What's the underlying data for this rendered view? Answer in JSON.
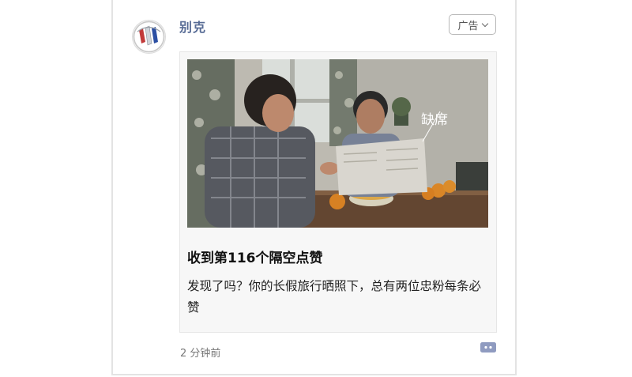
{
  "post": {
    "author": "别克",
    "ad_label": "广告",
    "headline": "收到第116个隔空点赞",
    "description": "发现了吗？你的长假旅行晒照下，总有两位忠粉每条必赞",
    "time": "2 分钟前",
    "photo_overlay_text": "缺席"
  },
  "icons": {
    "avatar": "buick-logo",
    "ad_menu": "chevron-down-icon",
    "comment": "comment-icon"
  },
  "colors": {
    "author_name": "#576b95",
    "comment_icon": "#8f9bc0"
  }
}
